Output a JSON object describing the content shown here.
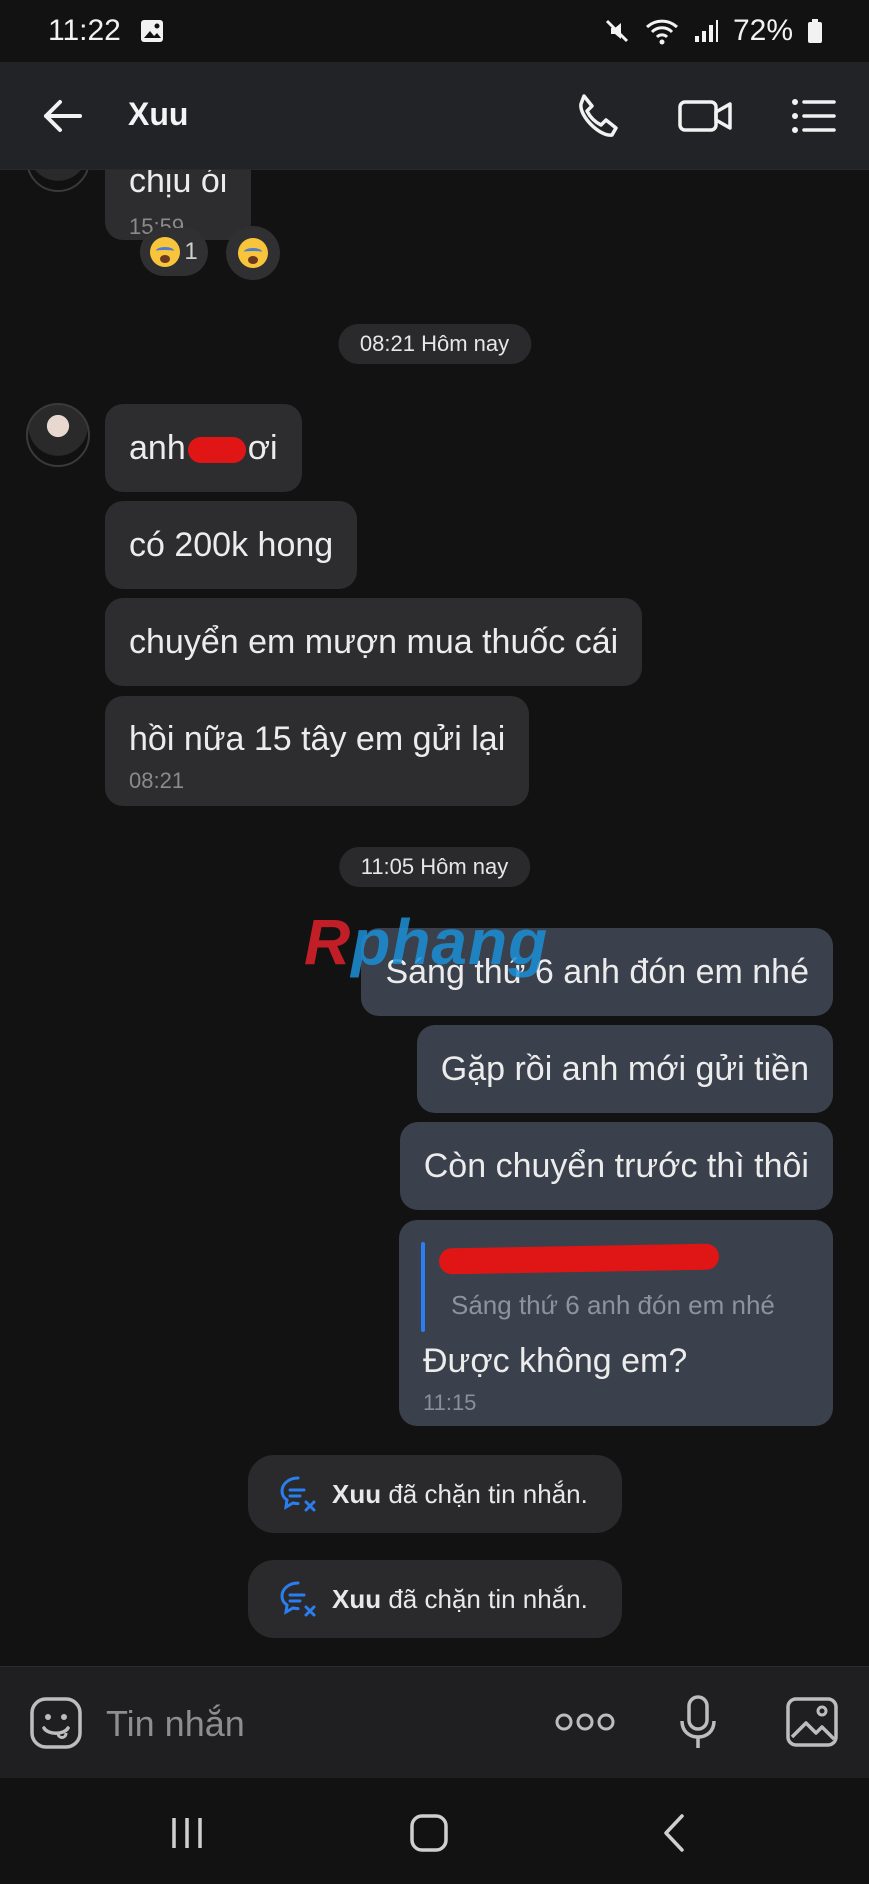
{
  "status_bar": {
    "time": "11:22",
    "battery": "72%"
  },
  "header": {
    "title": "Xuu"
  },
  "messages": {
    "top_partial": {
      "text": "chịu ói",
      "time": "15:59",
      "reaction_count": "1"
    },
    "date_1": "08:21 Hôm nay",
    "incoming": [
      {
        "before": "anh",
        "after": "ơi"
      },
      {
        "text": "có 200k hong"
      },
      {
        "text": "chuyển em mượn mua thuốc cái"
      },
      {
        "text": "hồi nữa 15 tây em gửi lại",
        "time": "08:21"
      }
    ],
    "date_2": "11:05 Hôm nay",
    "outgoing": [
      {
        "text": "Sáng thứ 6 anh đón em nhé"
      },
      {
        "text": "Gặp rồi anh mới gửi tiền"
      },
      {
        "text": "Còn chuyển trước thì thôi"
      }
    ],
    "reply": {
      "quoted_text": "Sáng thứ 6 anh đón em nhé",
      "text": "Được không em?",
      "time": "11:15"
    },
    "system": [
      {
        "name": "Xuu",
        "text": "đã chặn tin nhắn."
      },
      {
        "name": "Xuu",
        "text": "đã chặn tin nhắn."
      }
    ]
  },
  "watermark": {
    "first": "R",
    "rest": "phang"
  },
  "composer": {
    "placeholder": "Tin nhắn"
  },
  "icons": {
    "back": "arrow-left-icon",
    "call": "phone-icon",
    "video": "video-camera-icon",
    "menu": "list-menu-icon",
    "emoji": "sticker-face-icon",
    "more": "more-dots-icon",
    "mic": "microphone-icon",
    "gallery": "image-gallery-icon"
  },
  "colors": {
    "background": "#121212",
    "incoming_bubble": "#2d2d30",
    "outgoing_bubble": "#3a404c",
    "accent": "#2b7ef0",
    "system_icon": "#2b7ef0"
  }
}
